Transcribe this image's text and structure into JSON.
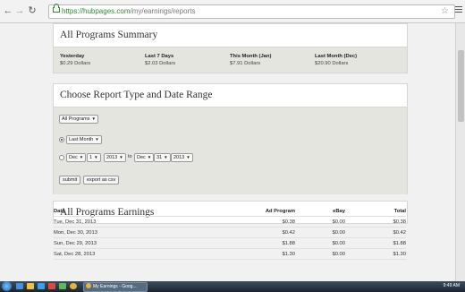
{
  "browser": {
    "url_domain": "https://hubpages.com",
    "url_path": "/my/earnings/reports"
  },
  "summary": {
    "title": "All Programs Summary",
    "items": [
      {
        "label": "Yesterday",
        "value": "$0.29 Dollars"
      },
      {
        "label": "Last 7 Days",
        "value": "$2.03 Dollars"
      },
      {
        "label": "This Month (Jan)",
        "value": "$7.91 Dollars"
      },
      {
        "label": "Last Month (Dec)",
        "value": "$20.90 Dollars"
      }
    ]
  },
  "report": {
    "title": "Choose Report Type and Date Range",
    "program_select": "All Programs",
    "range_select": "Last Month",
    "from_month": "Dec",
    "from_day": "1",
    "from_year": "2013",
    "to_label": "to",
    "to_month": "Dec",
    "to_day": "31",
    "to_year": "2013",
    "submit_label": "submit",
    "export_label": "export as csv"
  },
  "earnings": {
    "title": "All Programs Earnings",
    "columns": [
      "Date",
      "Ad Program",
      "eBay",
      "Total"
    ],
    "rows": [
      [
        "Tue, Dec 31, 2013",
        "$0.38",
        "$0.00",
        "$0.38"
      ],
      [
        "Mon, Dec 30, 2013",
        "$0.42",
        "$0.00",
        "$0.42"
      ],
      [
        "Sun, Dec 29, 2013",
        "$1.88",
        "$0.00",
        "$1.88"
      ],
      [
        "Sat, Dec 28, 2013",
        "$1.30",
        "$0.00",
        "$1.30"
      ]
    ]
  },
  "taskbar": {
    "task_label": "My Earnings - Goog...",
    "clock": "9:49 AM"
  }
}
